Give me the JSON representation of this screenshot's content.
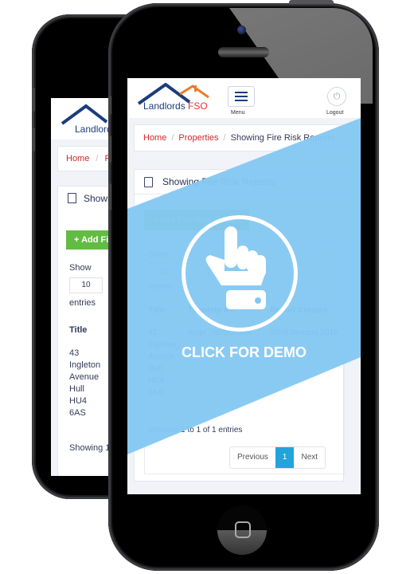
{
  "app": {
    "brand": {
      "name_part1": "Landlords ",
      "name_part2": "FSO"
    },
    "header": {
      "menu_label": "Menu",
      "logout_label": "Logout"
    },
    "breadcrumb": {
      "home": "Home",
      "separator": "/",
      "properties": "Properties",
      "current": "Showing Fire Risk Reports"
    },
    "panel": {
      "title": "Showing Fire Risk Reports",
      "add_button": "+ Add Fire Risk Report",
      "length_menu": {
        "prefix": "Show",
        "value": "10",
        "suffix": "entries"
      },
      "table": {
        "columns": [
          "Title",
          "Property Ref",
          "Report Created"
        ],
        "rows": [
          {
            "title_lines": [
              "43",
              "Ingleton",
              "Avenue",
              "Hull",
              "HU4",
              "6AS"
            ],
            "property_ref": "fsopr_c5d3c9596f",
            "report_created": "22nd January 2018"
          }
        ]
      },
      "info": "Showing 1 to 1 of 1 entries",
      "pagination": {
        "previous": "Previous",
        "current_page": "1",
        "next": "Next"
      }
    },
    "back_phone": {
      "breadcrumb_home": "Home",
      "breadcrumb_next": "P",
      "panel_title": "Showi",
      "add_button": "+ Add Fi",
      "info": "Showing 1"
    }
  },
  "overlay": {
    "cta": "CLICK FOR DEMO",
    "icon": "pointing-hand-icon"
  },
  "colors": {
    "accent_blue": "#84c8f2",
    "brand_navy": "#1c3c7c",
    "brand_red": "#e53232",
    "add_green": "#62bc44",
    "page_active": "#22a3dc"
  }
}
